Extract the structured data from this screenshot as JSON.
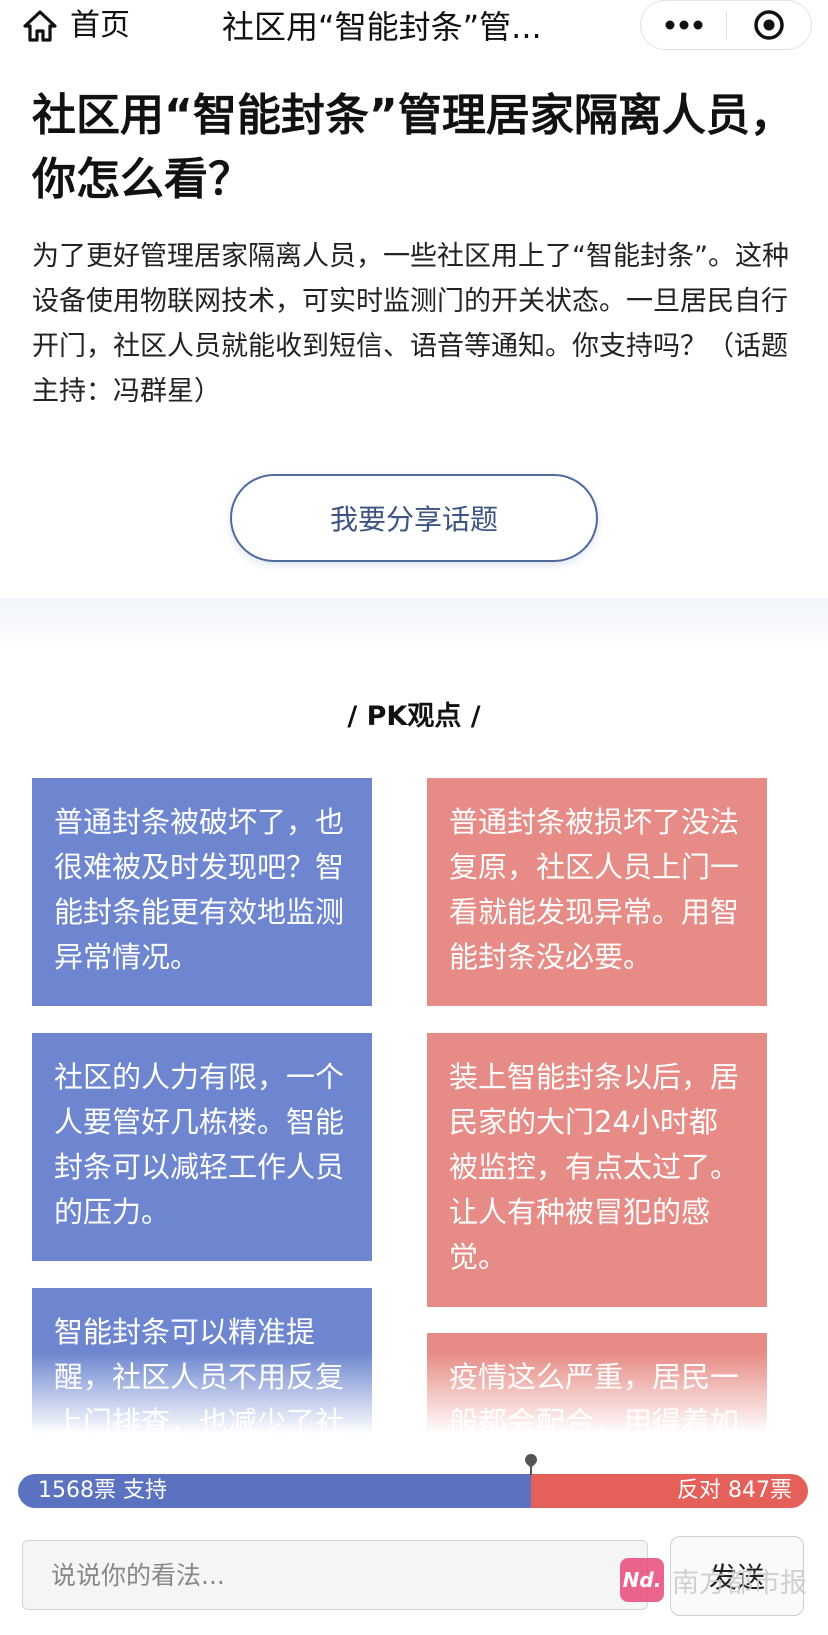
{
  "nav": {
    "home_label": "首页",
    "title": "社区用“智能封条”管...",
    "more_icon": "more-dots-icon",
    "close_icon": "record-close-icon"
  },
  "article": {
    "headline": "社区用“智能封条”管理居家隔离人员，你怎么看？",
    "intro": "为了更好管理居家隔离人员，一些社区用上了“智能封条”。这种设备使用物联网技术，可实时监测门的开关状态。一旦居民自行开门，社区人员就能收到短信、语音等通知。你支持吗？（话题主持：冯群星）",
    "share_button": "我要分享话题"
  },
  "pk": {
    "title": "/ PK观点 /",
    "support_points": [
      "普通封条被破坏了，也很难被及时发现吧？智能封条能更有效地监测异常情况。",
      "社区的人力有限，一个人要管好几栋楼。智能封条可以减轻工作人员的压力。",
      "智能封条可以精准提醒，社区人员不用反复上门排查，也减少了社"
    ],
    "oppose_points": [
      "普通封条被损坏了没法复原，社区人员上门一看就能发现异常。用智能封条没必要。",
      "装上智能封条以后，居民家的大门24小时都被监控，有点太过了。让人有种被冒犯的感觉。",
      "疫情这么严重，居民一般都会配合，用得着如"
    ]
  },
  "vote": {
    "support_text": "1568票 支持",
    "oppose_text": "反对 847票",
    "support_votes": 1568,
    "oppose_votes": 847,
    "support_color": "#5a72bf",
    "oppose_color": "#e6605a"
  },
  "comment": {
    "placeholder": "说说你的看法...",
    "send_label": "发送"
  },
  "watermark": {
    "logo_text": "Nd.",
    "text": "南方都市报"
  },
  "colors": {
    "support_card": "#6d86cf",
    "oppose_card": "#e68b85",
    "accent": "#4f6a9e"
  }
}
